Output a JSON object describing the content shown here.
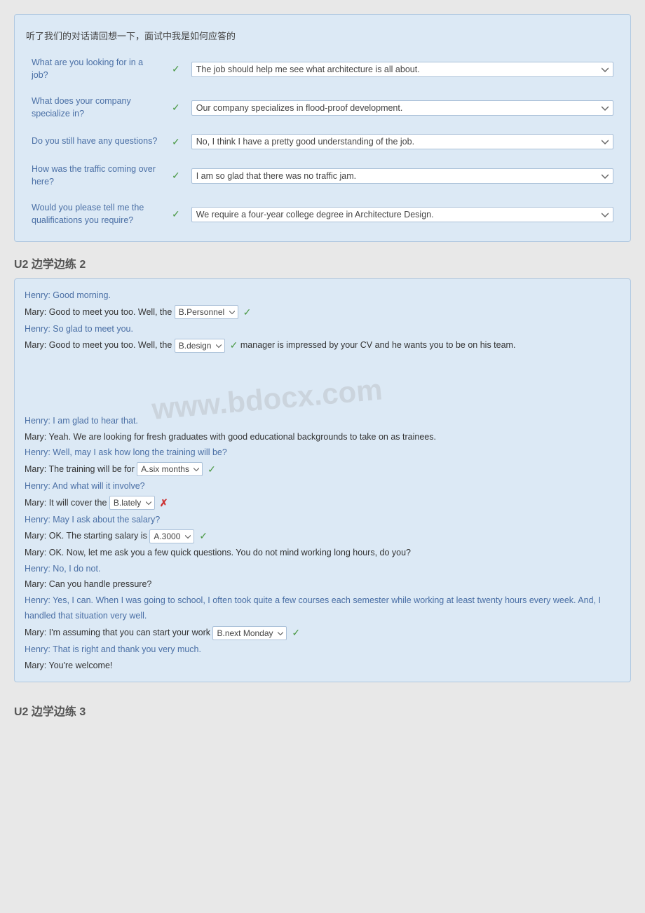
{
  "exercise1": {
    "instruction": "听了我们的对话请回想一下，面试中我是如何应答的",
    "rows": [
      {
        "question": "What are you looking for in a job?",
        "answer": "The job should help me see what architecture is all about.",
        "checked": true
      },
      {
        "question": "What does your company specialize in?",
        "answer": "Our company specializes in flood-proof development.",
        "checked": true
      },
      {
        "question": "Do you still have any questions?",
        "answer": "No, I think I have a pretty good understanding of the job.",
        "checked": true
      },
      {
        "question": "How was the traffic coming over here?",
        "answer": "I am so glad that there was no traffic jam.",
        "checked": true
      },
      {
        "question": "Would you please tell me the qualifications you require?",
        "answer": "We require a four-year college degree in Architecture Design.",
        "checked": true
      }
    ]
  },
  "u2_header1": "U2 边学边练 2",
  "exercise2": {
    "lines": [
      {
        "speaker": "Henry",
        "type": "henry",
        "text": "Good morning."
      },
      {
        "speaker": "Mary",
        "type": "mary",
        "text": "Good to meet you too. Well, the",
        "has_select": true,
        "select_id": "s1",
        "select_value": "B.Personnel",
        "after_text": "",
        "has_check": true,
        "check_correct": true
      },
      {
        "speaker": "Henry",
        "type": "henry",
        "text": "So glad to meet you."
      },
      {
        "speaker": "Mary",
        "type": "mary",
        "text": "Good to meet you too. Well, the",
        "has_select": true,
        "select_id": "s2",
        "select_value": "B.design",
        "after_text": " manager is impressed by your CV and he wants you to be on his team.",
        "has_check": true,
        "check_correct": true
      },
      {
        "speaker": "Henry",
        "type": "henry",
        "text": "I am glad to hear that."
      },
      {
        "speaker": "Mary",
        "type": "mary",
        "text": "Yeah. We are looking for fresh graduates with good educational backgrounds to take on as trainees."
      },
      {
        "speaker": "Henry",
        "type": "henry",
        "text": "Well, may I ask how long the training will be?"
      },
      {
        "speaker": "Mary",
        "type": "mary",
        "text": "The training will be for",
        "has_select": true,
        "select_id": "s3",
        "select_value": "A.six months",
        "after_text": "",
        "has_check": true,
        "check_correct": true
      },
      {
        "speaker": "Henry",
        "type": "henry",
        "text": "And what will it involve?"
      },
      {
        "speaker": "Mary",
        "type": "mary",
        "text": "It will cover the",
        "has_select": true,
        "select_id": "s4",
        "select_value": "B.lately",
        "after_text": "",
        "has_check": false,
        "has_cross": true
      },
      {
        "speaker": "Henry",
        "type": "henry",
        "text": "May I ask about the salary?"
      },
      {
        "speaker": "Mary",
        "type": "mary",
        "text": "OK. The starting salary is",
        "has_select": true,
        "select_id": "s5",
        "select_value": "A.3000",
        "after_text": "",
        "has_check": true,
        "check_correct": true
      },
      {
        "speaker": "Mary",
        "type": "mary",
        "text": "OK. Now, let me ask you a few quick questions. You do not mind working long hours, do you?"
      },
      {
        "speaker": "Henry",
        "type": "henry",
        "text": "No, I do not."
      },
      {
        "speaker": "Mary",
        "type": "mary",
        "text": "Can you handle pressure?"
      },
      {
        "speaker": "Henry",
        "type": "henry",
        "text": "Yes, I can. When I was going to school, I often took quite a few courses each semester while working at least twenty hours every week. And, I handled that situation very well."
      },
      {
        "speaker": "Mary",
        "type": "mary",
        "text": "I'm assuming that you can start your work",
        "has_select": true,
        "select_id": "s6",
        "select_value": "B.next Monday",
        "after_text": "",
        "has_check": true,
        "check_correct": true
      },
      {
        "speaker": "Henry",
        "type": "henry",
        "text": "That is right and thank you very much."
      },
      {
        "speaker": "Mary",
        "type": "mary",
        "text": "You're welcome!"
      }
    ]
  },
  "u2_header2": "U2 边学边练 3",
  "watermark_text": "www.bdocx.com"
}
